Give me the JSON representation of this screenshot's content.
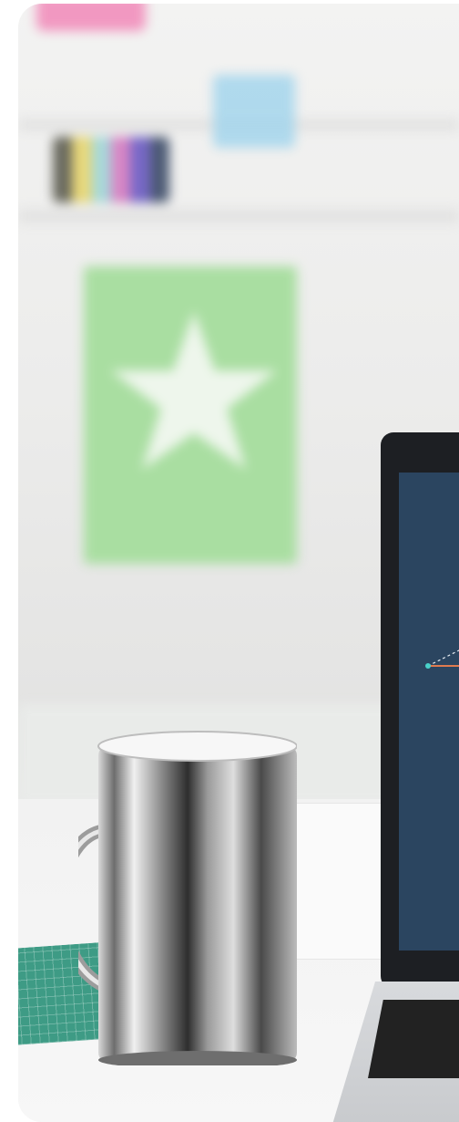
{
  "image": {
    "alt": "",
    "colors": {
      "background": "#ffffff",
      "wall": "#ececeb",
      "green_poster": "#a9dea1",
      "blue_note": "#9fd3ec",
      "pink_note": "#f07ab0",
      "laptop_screen": "#2b4560",
      "cutting_mat": "#3e9b85"
    }
  },
  "objects": {
    "mug_icon": "chrome-mug-icon",
    "star_icon": "star-icon",
    "laptop_icon": "laptop-icon"
  }
}
